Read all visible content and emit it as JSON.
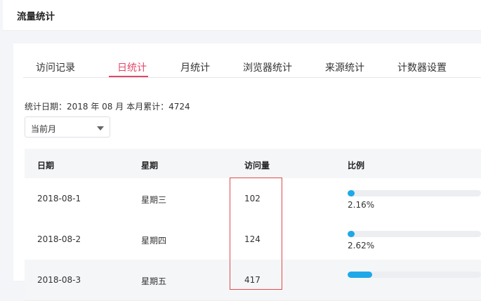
{
  "header": {
    "title": "流量统计"
  },
  "tabs": [
    {
      "label": "访问记录",
      "active": false
    },
    {
      "label": "日统计",
      "active": true
    },
    {
      "label": "月统计",
      "active": false
    },
    {
      "label": "浏览器统计",
      "active": false
    },
    {
      "label": "来源统计",
      "active": false
    },
    {
      "label": "计数器设置",
      "active": false
    }
  ],
  "stats": {
    "text": "统计日期：2018 年 08 月 本月累计：4724"
  },
  "month_select": {
    "value": "当前月"
  },
  "table": {
    "columns": [
      "日期",
      "星期",
      "访问量",
      "比例"
    ],
    "rows": [
      {
        "date": "2018-08-1",
        "weekday": "星期三",
        "visits": "102",
        "percent": "2.16%",
        "ratio": 0.0216
      },
      {
        "date": "2018-08-2",
        "weekday": "星期四",
        "visits": "124",
        "percent": "2.62%",
        "ratio": 0.0262
      },
      {
        "date": "2018-08-3",
        "weekday": "星期五",
        "visits": "417",
        "percent": "",
        "ratio": 0.0882
      }
    ]
  },
  "colors": {
    "accent": "#e0476b",
    "bar": "#1fa8e8",
    "highlight": "#e34a4a"
  }
}
